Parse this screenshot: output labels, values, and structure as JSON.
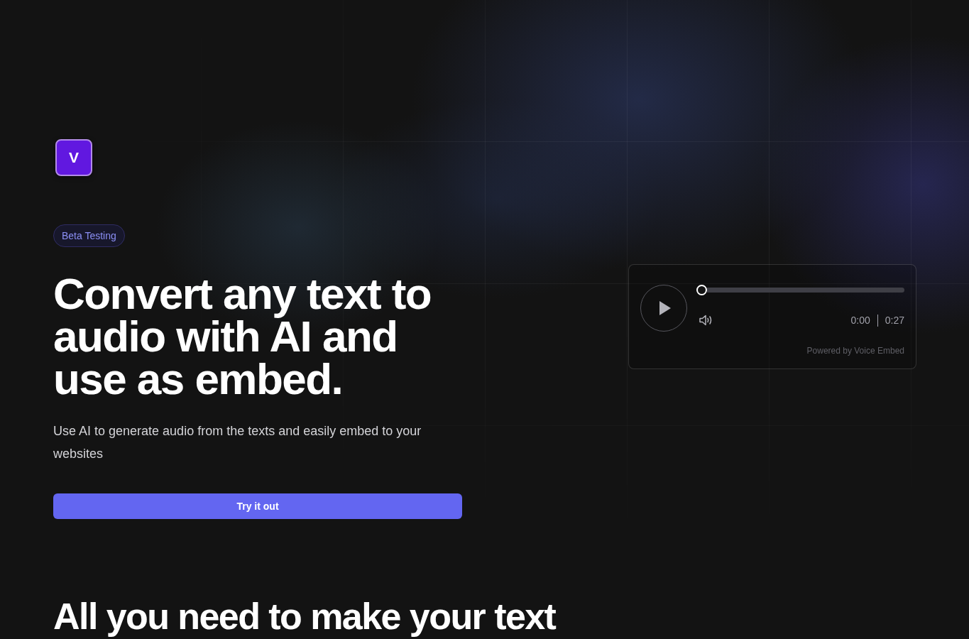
{
  "logo": {
    "letter": "V"
  },
  "badge": "Beta Testing",
  "headline": "Convert any text to audio with AI and use as embed.",
  "subheadline": "Use AI to generate audio from the texts and easily embed to your websites",
  "cta_button": "Try it out",
  "player": {
    "progress": {
      "level": 0
    },
    "current_time": "0:00",
    "duration": "0:27",
    "credit": "Powered by Voice Embed"
  },
  "section_heading": "All you need to make your text"
}
